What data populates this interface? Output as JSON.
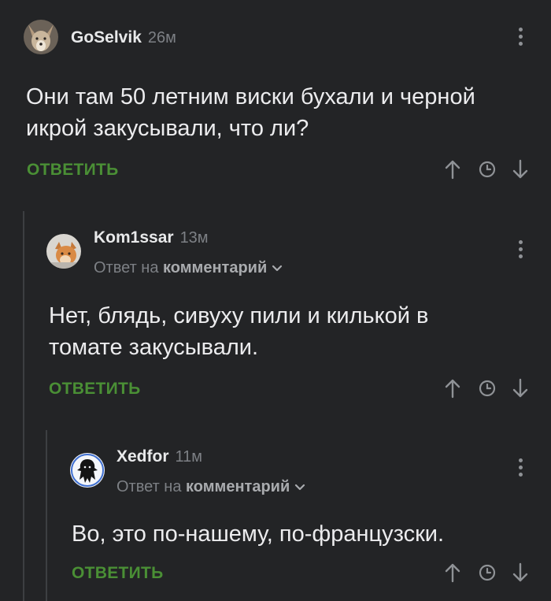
{
  "comments": [
    {
      "author": "GoSelvik",
      "time": "26м",
      "text_lines": [
        "Они там 50 летним виски бухали и черной",
        "икрой закусывали, что ли?"
      ],
      "reply_label": "ОТВЕТИТЬ",
      "avatar_icon": "fox-avatar-icon"
    },
    {
      "author": "Kom1ssar",
      "time": "13м",
      "reply_prefix": "Ответ на",
      "reply_target": "комментарий",
      "text_lines": [
        "Нет, блядь, сивуху пили и килькой в",
        "томате закусывали."
      ],
      "reply_label": "ОТВЕТИТЬ",
      "avatar_icon": "cat-avatar-icon"
    },
    {
      "author": "Xedfor",
      "time": "11м",
      "reply_prefix": "Ответ на",
      "reply_target": "комментарий",
      "text_lines": [
        "Во, это по-нашему, по-французски."
      ],
      "reply_label": "ОТВЕТИТЬ",
      "avatar_icon": "silhouette-avatar-icon"
    }
  ],
  "colors": {
    "background": "#232426",
    "accent_green": "#4a8f35",
    "muted_text": "#7d8085",
    "thread_line": "#3d3f42"
  },
  "icons": {
    "upvote": "arrow-up-icon",
    "save": "clock-icon",
    "downvote": "arrow-down-icon",
    "menu": "more-vertical-icon",
    "expand": "chevron-down-icon"
  }
}
